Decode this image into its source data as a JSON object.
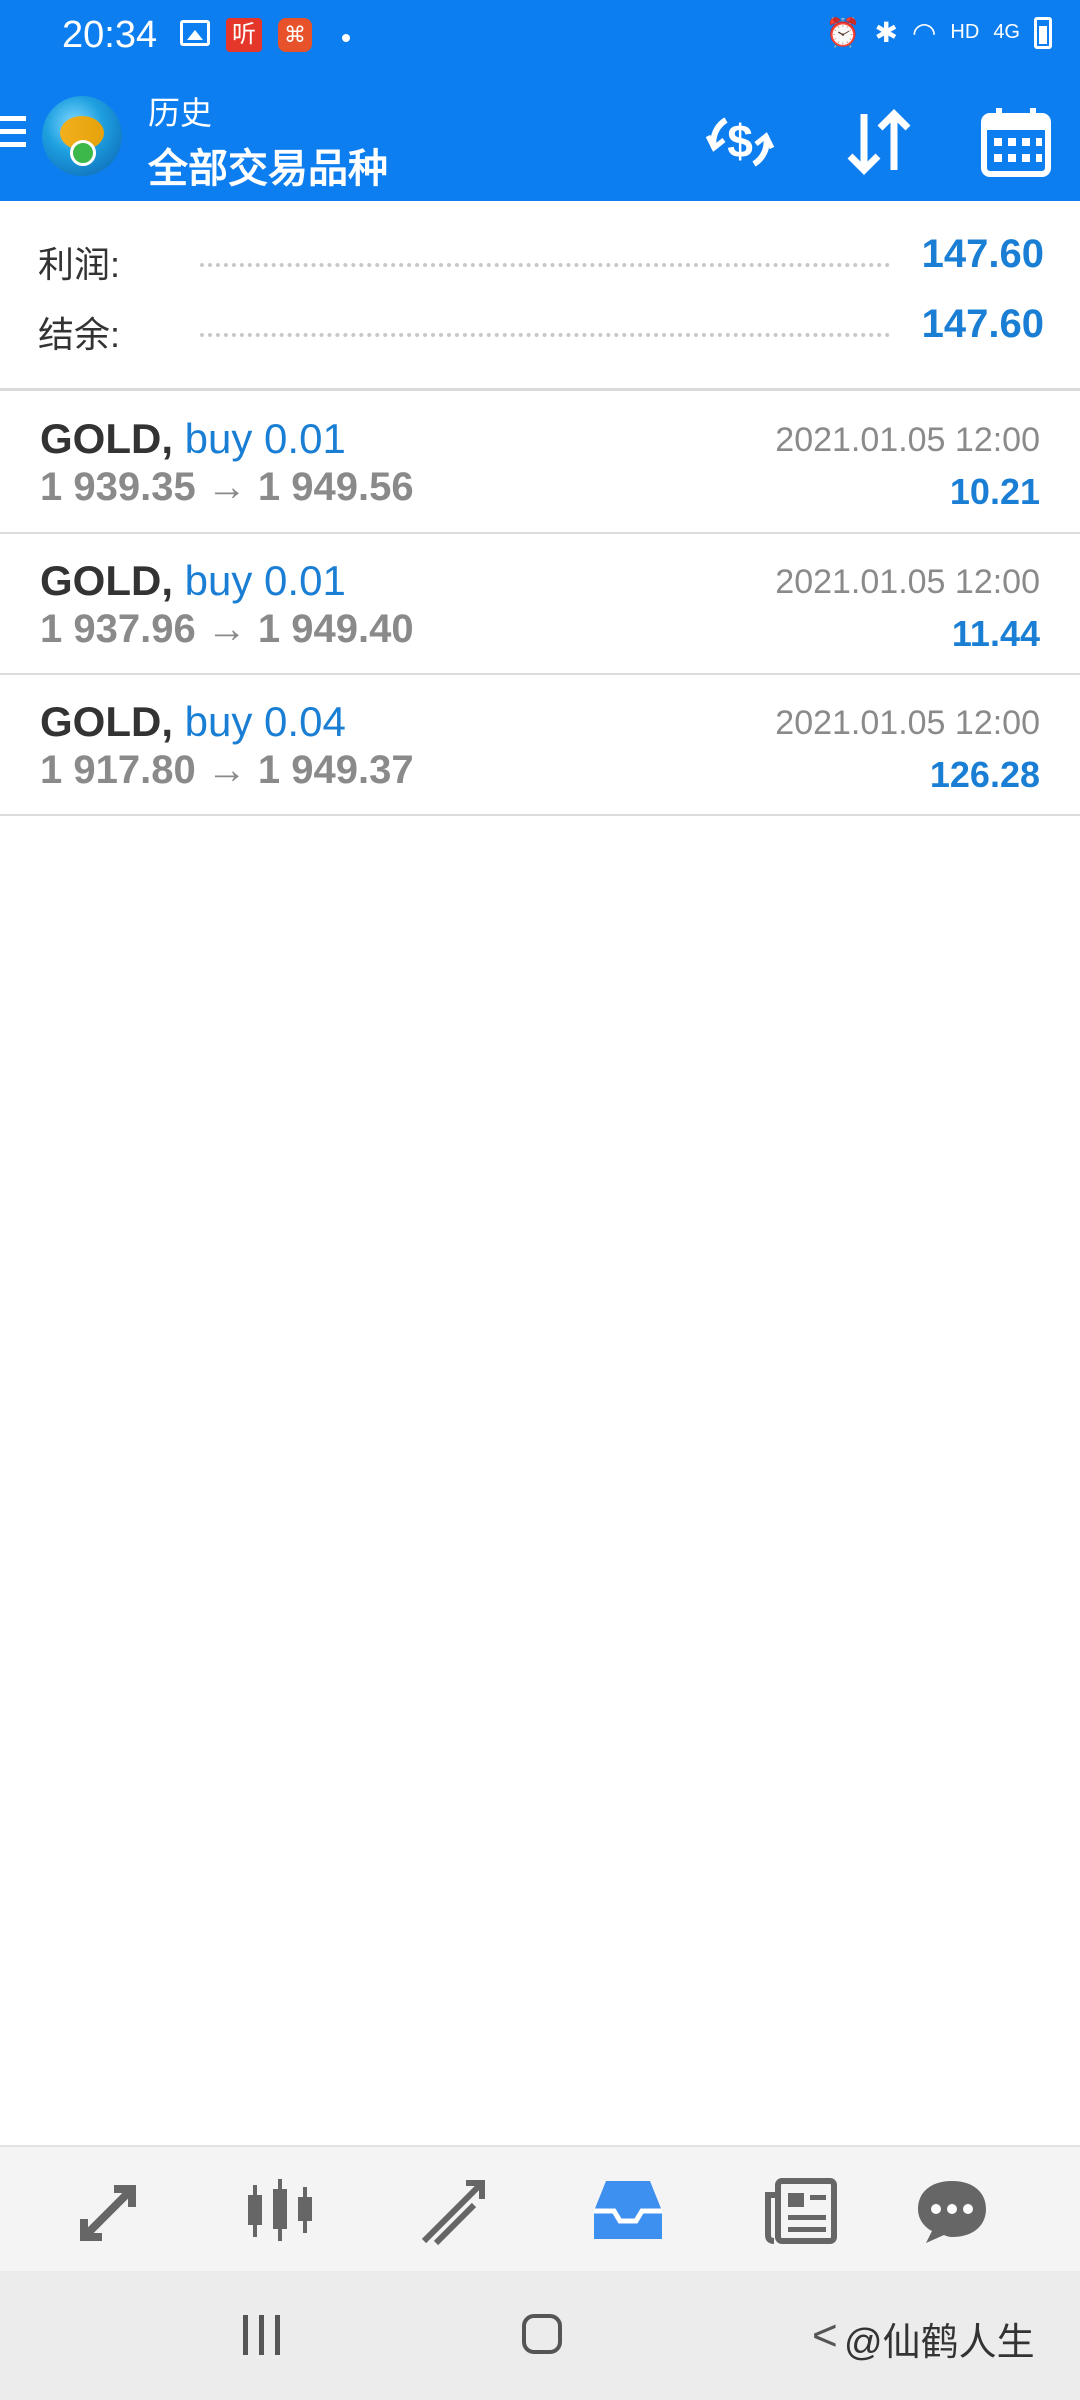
{
  "status_bar": {
    "time": "20:34",
    "notification_icons": [
      "image-icon",
      "ting-app-icon",
      "app-icon"
    ],
    "ting_text": "听",
    "app_text": "⌘",
    "network": "HD",
    "signal": "4G"
  },
  "header": {
    "subtitle": "历史",
    "title": "全部交易品种"
  },
  "summary": {
    "profit_label": "利润:",
    "profit_value": "147.60",
    "balance_label": "结余:",
    "balance_value": "147.60"
  },
  "deals": [
    {
      "symbol": "GOLD",
      "side": "buy 0.01",
      "prices": "1 939.35 → 1 949.56",
      "time": "2021.01.05 12:00",
      "profit": "10.21"
    },
    {
      "symbol": "GOLD",
      "side": "buy 0.01",
      "prices": "1 937.96 → 1 949.40",
      "time": "2021.01.05 12:00",
      "profit": "11.44"
    },
    {
      "symbol": "GOLD",
      "side": "buy 0.04",
      "prices": "1 917.80 → 1 949.37",
      "time": "2021.01.05 12:00",
      "profit": "126.28"
    }
  ],
  "bottom_nav": {
    "items": [
      "quotes-icon",
      "chart-icon",
      "trade-icon",
      "history-icon",
      "news-icon",
      "chat-icon"
    ],
    "active": "history-icon",
    "active_color": "#3d8ff0"
  },
  "watermark": "@仙鹤人生",
  "accent_color": "#0d7ef0"
}
